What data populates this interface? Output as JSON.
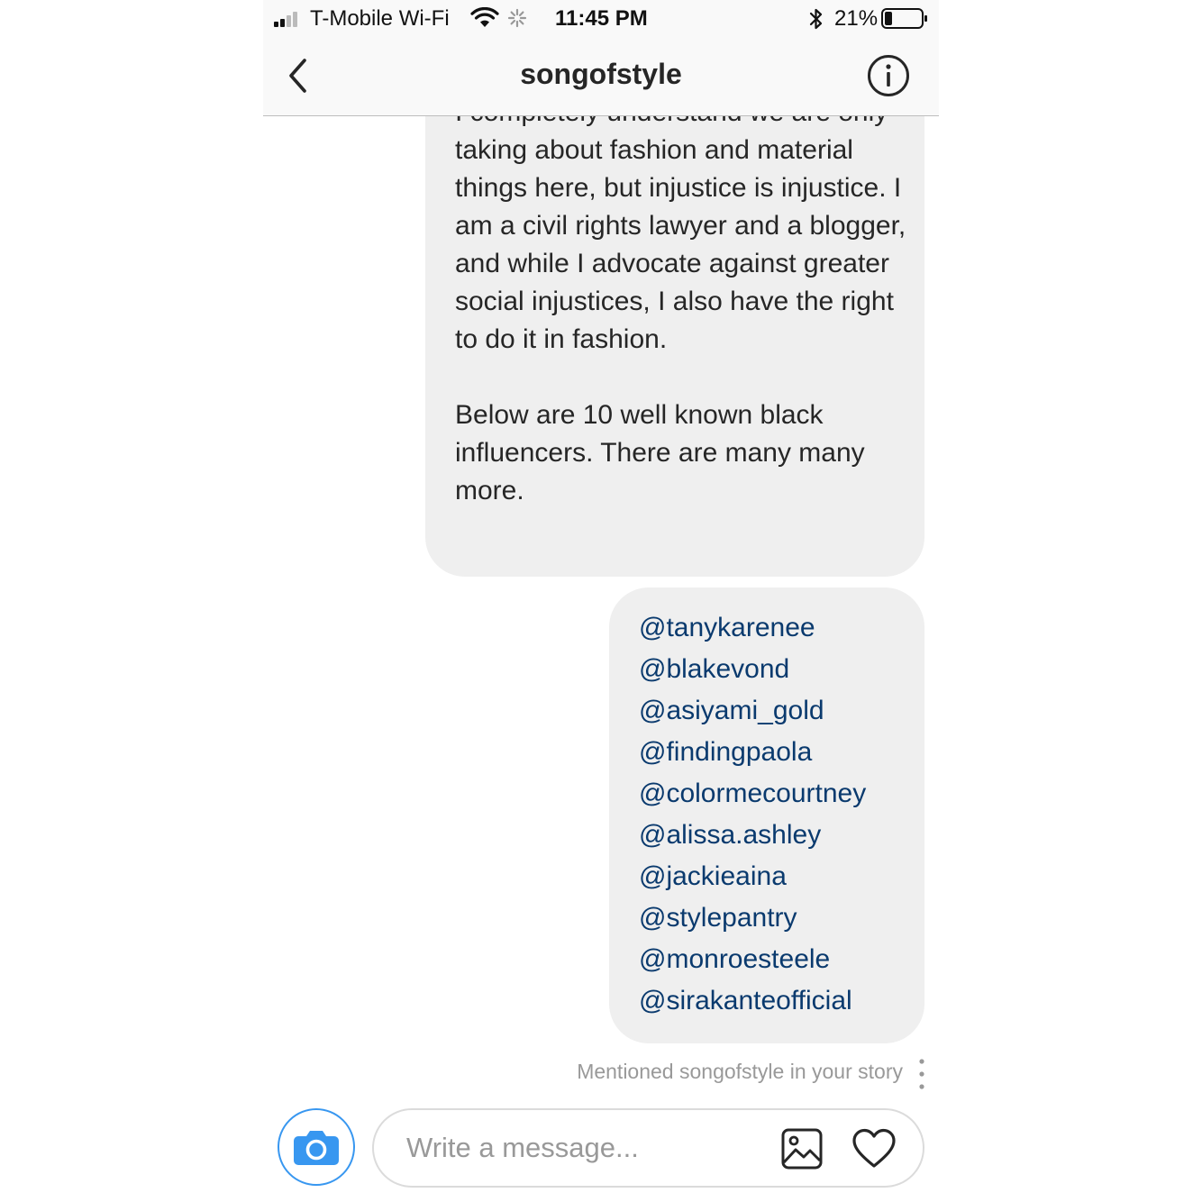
{
  "status_bar": {
    "carrier": "T-Mobile Wi-Fi",
    "time": "11:45 PM",
    "battery_percent": "21%",
    "battery_level": 0.21,
    "signal_bars_filled": 2,
    "signal_bars_total": 4,
    "icons": [
      "signal-icon",
      "wifi-icon",
      "activity-spinner-icon",
      "bluetooth-icon",
      "battery-icon"
    ]
  },
  "header": {
    "title": "songofstyle",
    "back_icon": "chevron-left-icon",
    "info_icon": "info-icon"
  },
  "messages": [
    {
      "sender": "me",
      "paragraphs": [
        "I completely understand we are only taking about fashion and material things here, but injustice is injustice. I am a civil rights lawyer and a blogger, and while I advocate against greater social injustices, I also have the right to do it in fashion.",
        "Below are 10 well known black influencers. There are many many more."
      ]
    },
    {
      "sender": "me",
      "mentions": [
        "@tanykarenee",
        "@blakevond",
        "@asiyami_gold",
        "@findingpaola",
        "@colormecourtney",
        "@alissa.ashley",
        "@jackieaina",
        "@stylepantry",
        "@monroesteele",
        "@sirakanteofficial"
      ]
    }
  ],
  "story_note": "Mentioned songofstyle in your story",
  "composer": {
    "placeholder": "Write a message...",
    "camera_icon": "camera-icon",
    "gallery_icon": "gallery-icon",
    "heart_icon": "heart-icon"
  },
  "colors": {
    "accent": "#3897f0",
    "bubble": "#efefef",
    "mention_link": "#0a3a6e",
    "muted_text": "#999999",
    "header_bg": "#f9f9f9"
  }
}
